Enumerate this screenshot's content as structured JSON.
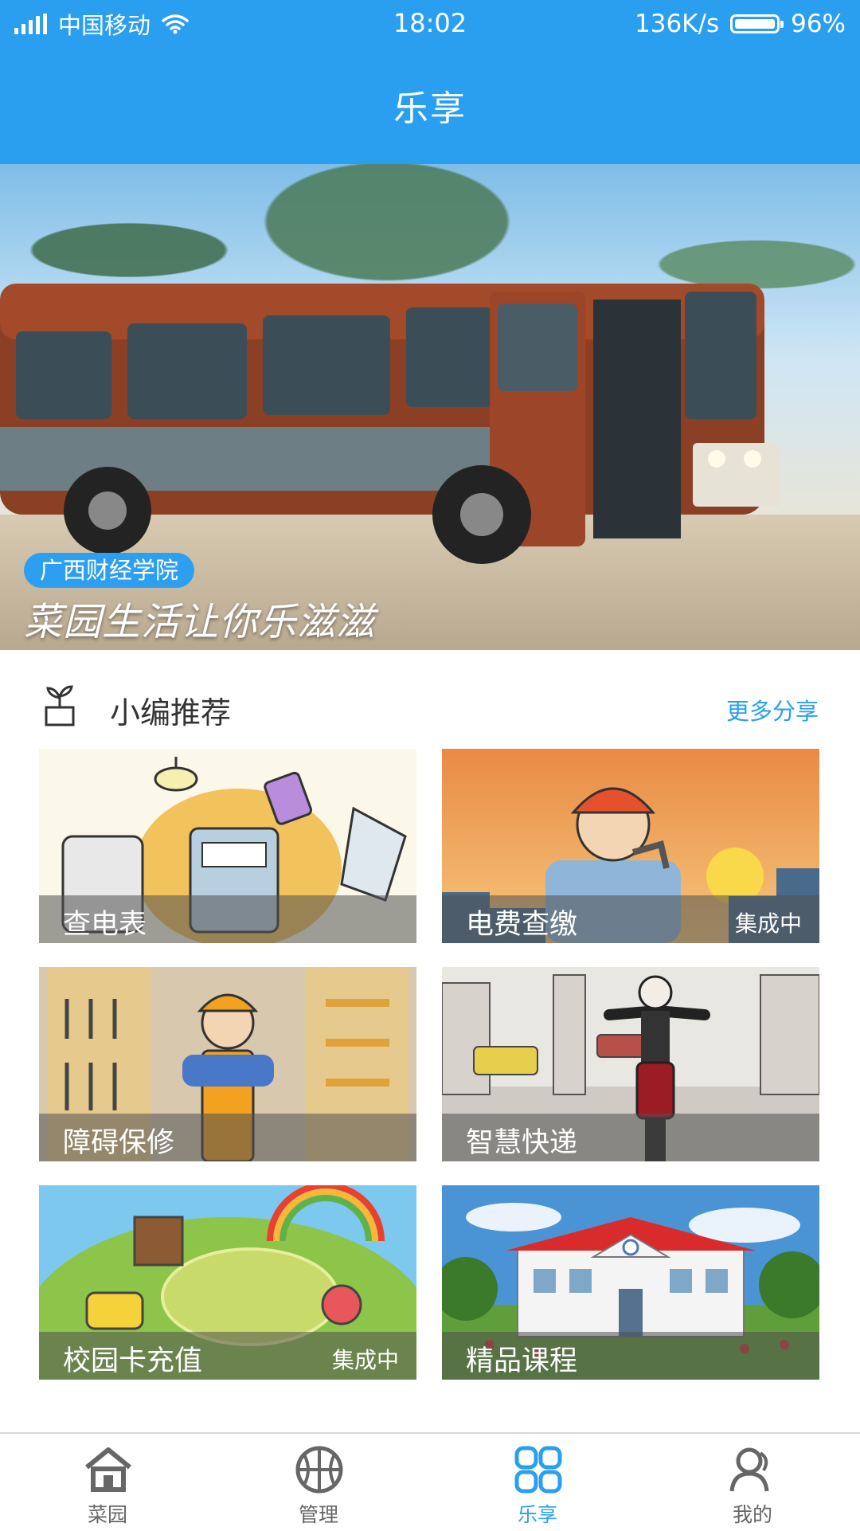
{
  "status_bar": {
    "carrier": "中国移动",
    "time": "18:02",
    "speed": "136K/s",
    "battery": "96%",
    "battery_level": 0.96
  },
  "header": {
    "title": "乐享"
  },
  "banner": {
    "tag": "广西财经学院",
    "slogan": "菜园生活让你乐滋滋"
  },
  "section": {
    "title": "小编推荐",
    "more": "更多分享",
    "icon": "sprout-pot-icon"
  },
  "tiles": [
    {
      "name": "查电表",
      "badge": ""
    },
    {
      "name": "电费查缴",
      "badge": "集成中"
    },
    {
      "name": "障碍保修",
      "badge": ""
    },
    {
      "name": "智慧快递",
      "badge": ""
    },
    {
      "name": "校园卡充值",
      "badge": "集成中"
    },
    {
      "name": "精品课程",
      "badge": ""
    }
  ],
  "nav": [
    {
      "label": "菜园",
      "icon": "home-icon",
      "active": false
    },
    {
      "label": "管理",
      "icon": "basketball-icon",
      "active": false
    },
    {
      "label": "乐享",
      "icon": "grid-icon",
      "active": true
    },
    {
      "label": "我的",
      "icon": "user-icon",
      "active": false
    }
  ],
  "colors": {
    "primary": "#2a9ff0",
    "nav_inactive": "#666666"
  }
}
